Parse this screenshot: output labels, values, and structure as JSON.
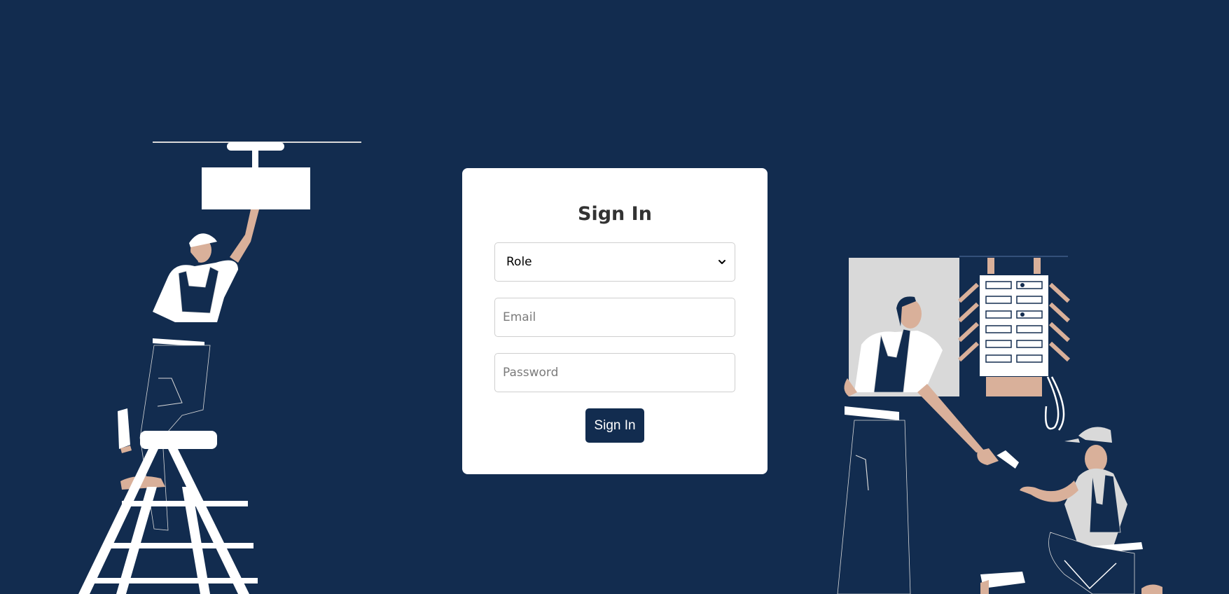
{
  "card": {
    "title": "Sign In",
    "role_select": {
      "selected": "Role"
    },
    "email": {
      "placeholder": "Email",
      "value": ""
    },
    "password": {
      "placeholder": "Password",
      "value": ""
    },
    "submit_label": "Sign In"
  },
  "colors": {
    "background": "#122c4f",
    "card": "#ffffff",
    "button": "#122c4f",
    "skin": "#d9b09a",
    "light_gray": "#d9d9d9"
  },
  "icons": {
    "select_arrow": "chevron-down-icon"
  }
}
